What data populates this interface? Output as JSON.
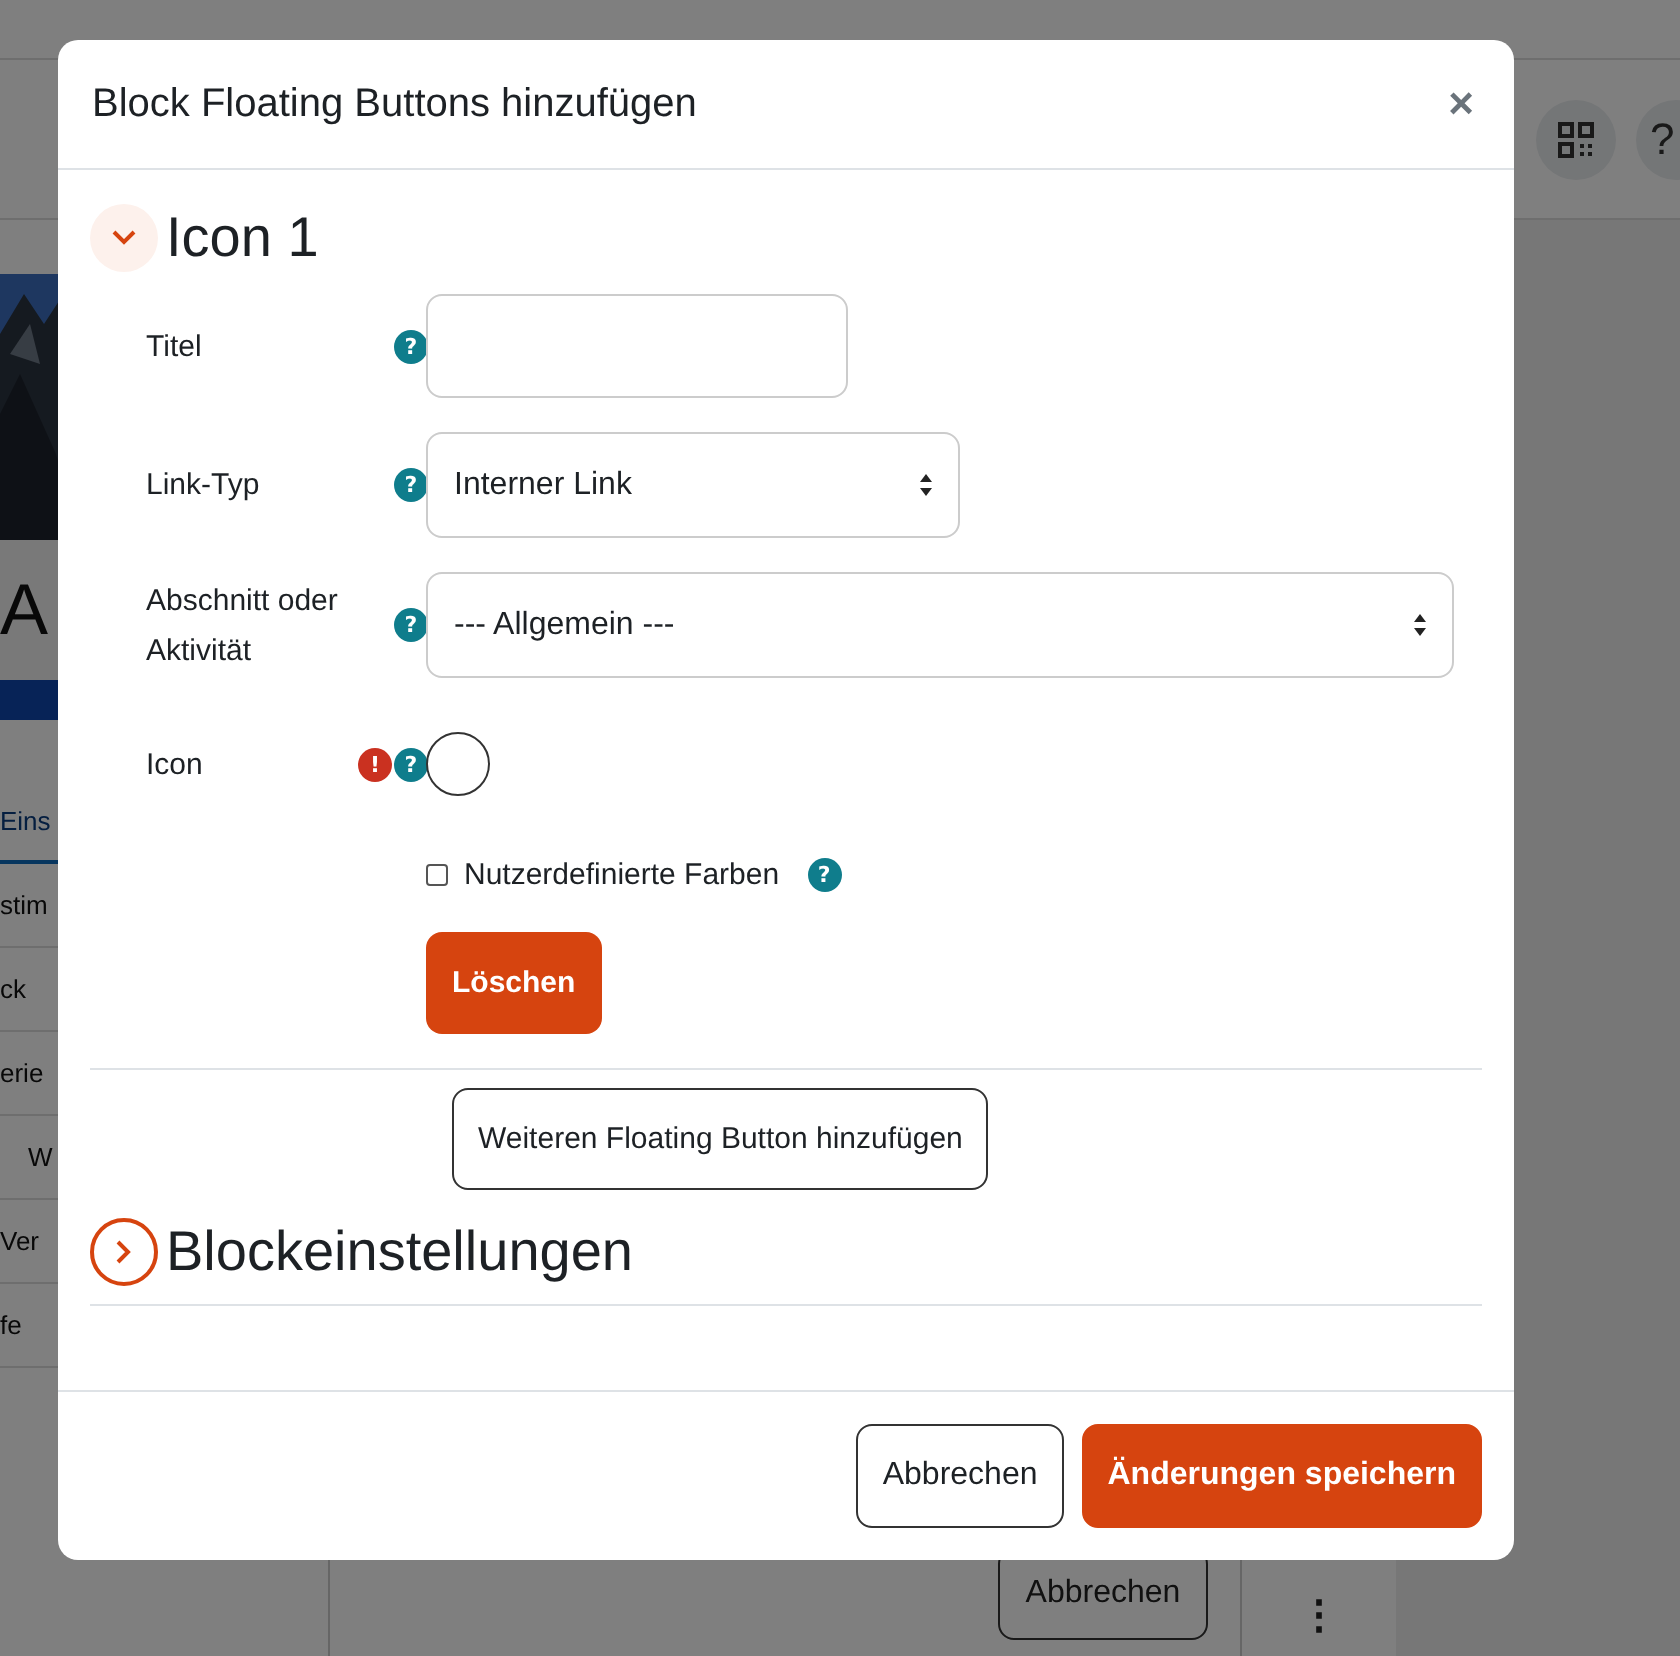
{
  "background": {
    "header_help": "?",
    "banner_text": "A",
    "nav_items": [
      {
        "label": "Eins",
        "selected": true
      },
      {
        "label": "stim",
        "selected": false
      },
      {
        "label": "ck",
        "selected": false
      },
      {
        "label": "erie",
        "selected": false,
        "children": [
          {
            "label": "W",
            "selected": false
          }
        ]
      },
      {
        "label": "Ver",
        "selected": false
      },
      {
        "label": "fe",
        "selected": false
      }
    ],
    "footer_button": "Abbrechen",
    "more": "⋮"
  },
  "dialog": {
    "title": "Block Floating Buttons hinzufügen",
    "close": "×",
    "sections": [
      {
        "title": "Icon 1",
        "expanded": true,
        "fields": [
          {
            "kind": "text",
            "label": "Titel",
            "help": "?"
          },
          {
            "kind": "select",
            "label": "Link-Typ",
            "help": "?",
            "value": "Interner Link"
          },
          {
            "kind": "wideselect",
            "label": "Abschnitt oder Aktivität",
            "help": "?",
            "value": "--- Allgemein ---"
          },
          {
            "kind": "icon-picker",
            "label": "Icon",
            "error": "!",
            "help": "?"
          },
          {
            "kind": "checkbox",
            "label": "Nutzerdefinierte Farben",
            "checked": false,
            "help": "?"
          },
          {
            "kind": "button",
            "label": "Löschen"
          }
        ],
        "add_button": "Weiteren Floating Button hinzufügen"
      },
      {
        "title": "Blockeinstellungen",
        "expanded": false
      }
    ],
    "buttons": [
      {
        "label": "Abbrechen",
        "kind": "secondary"
      },
      {
        "label": "Änderungen speichern",
        "kind": "primary"
      }
    ]
  }
}
